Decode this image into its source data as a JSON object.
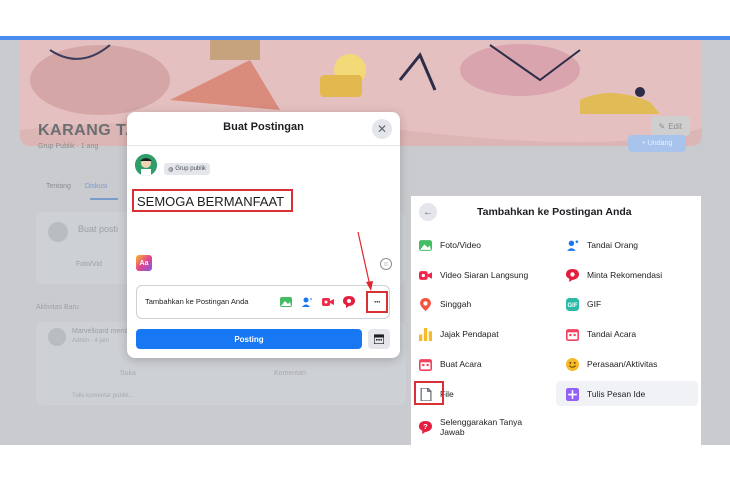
{
  "background": {
    "edit_label": "Edit",
    "group_name": "KARANG TA",
    "group_meta": "Grup Publik · 1 ang",
    "invite_label": "+ Undang",
    "tabs": [
      "Tentang",
      "Diskusi"
    ],
    "create_placeholder": "Buat posti",
    "create_photo_label": "Foto/Vid",
    "activity_label": "Aktivitas Baru",
    "feed_text": "Marvelloard membuat grup KARANG TARUNA BANGSA.",
    "feed_sub": "Admin · 4 jam",
    "feed_like": "Suka",
    "feed_comment": "Komentari",
    "feed_write": "Tulis komentar publik..."
  },
  "modal": {
    "title": "Buat Postingan",
    "privacy": "Grup publik",
    "post_text": "SEMOGA BERMANFAAT",
    "add_to_post": "Tambahkan ke Postingan Anda",
    "post_button": "Posting",
    "icons": [
      "photo-video-icon",
      "tag-people-icon",
      "live-video-icon",
      "recommendation-icon",
      "more-options-icon"
    ]
  },
  "panel": {
    "title": "Tambahkan ke Postingan Anda",
    "options_left": [
      {
        "label": "Foto/Video",
        "icon": "photo-video-icon",
        "color": "#45bd62"
      },
      {
        "label": "Video Siaran Langsung",
        "icon": "live-video-icon",
        "color": "#f02849"
      },
      {
        "label": "Singgah",
        "icon": "check-in-icon",
        "color": "#f5533d"
      },
      {
        "label": "Jajak Pendapat",
        "icon": "poll-icon",
        "color": "#f7b928"
      },
      {
        "label": "Buat Acara",
        "icon": "event-icon",
        "color": "#f3425f"
      },
      {
        "label": "File",
        "icon": "file-icon",
        "color": "#606770"
      },
      {
        "label": "Selenggarakan Tanya Jawab",
        "icon": "qa-icon",
        "color": "#e41e3f"
      }
    ],
    "options_right": [
      {
        "label": "Tandai Orang",
        "icon": "tag-people-icon",
        "color": "#1877f2"
      },
      {
        "label": "Minta Rekomendasi",
        "icon": "recommendation-icon",
        "color": "#e41e3f"
      },
      {
        "label": "GIF",
        "icon": "gif-icon",
        "color": "#2abba7"
      },
      {
        "label": "Tandai Acara",
        "icon": "tag-event-icon",
        "color": "#f3425f"
      },
      {
        "label": "Perasaan/Aktivitas",
        "icon": "feeling-icon",
        "color": "#f7b928"
      },
      {
        "label": "Tulis Pesan Ide",
        "icon": "idea-icon",
        "color": "#9360f7"
      }
    ]
  },
  "colors": {
    "primary": "#1877f2",
    "highlight": "#d93035",
    "topbar_accent": "#4a8bf0"
  }
}
